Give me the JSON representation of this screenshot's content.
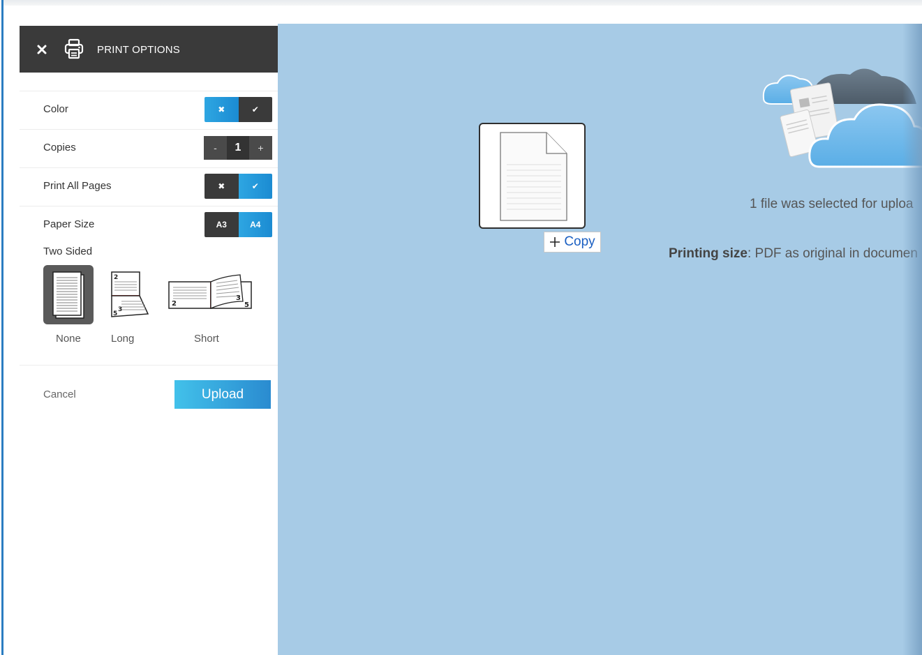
{
  "header": {
    "title": "PRINT OPTIONS"
  },
  "options": {
    "color": {
      "label": "Color",
      "off_glyph": "✖",
      "on_glyph": "✔",
      "selected": "off"
    },
    "copies": {
      "label": "Copies",
      "minus": "-",
      "value": "1",
      "plus": "+"
    },
    "print_all_pages": {
      "label": "Print All Pages",
      "off_glyph": "✖",
      "on_glyph": "✔",
      "selected": "on"
    },
    "paper_size": {
      "label": "Paper Size",
      "a3": "A3",
      "a4": "A4",
      "selected": "A4"
    }
  },
  "two_sided": {
    "label": "Two Sided",
    "options": [
      {
        "label": "None",
        "selected": true
      },
      {
        "label": "Long",
        "selected": false
      },
      {
        "label": "Short",
        "selected": false
      }
    ]
  },
  "actions": {
    "cancel": "Cancel",
    "upload": "Upload"
  },
  "main": {
    "copy_label": "Copy",
    "files_selected": "1 file was selected for uploa",
    "printing_size_label": "Printing size",
    "printing_size_value": ": PDF as original in documen"
  },
  "colors": {
    "header_bg": "#3a3a3a",
    "accent_blue": "#1b8bd2",
    "main_bg": "#a7cbe6",
    "upload_gradient_start": "#42c1ea",
    "upload_gradient_end": "#2a8bd0",
    "copy_text": "#1a5fc2"
  }
}
